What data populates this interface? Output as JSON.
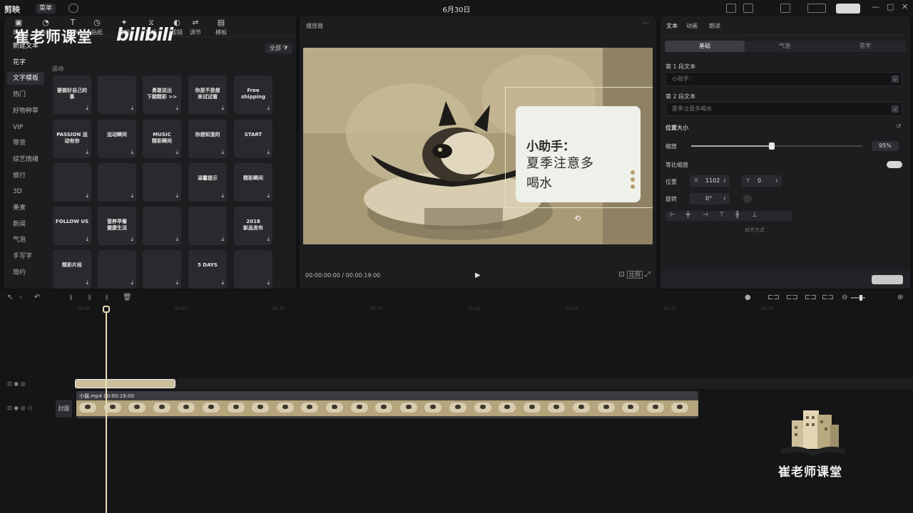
{
  "app": {
    "title": "6月30日",
    "logo": "剪映",
    "menu_label": "菜单"
  },
  "watermark": {
    "title": "崔老师课堂",
    "platform": "bilibili"
  },
  "tool_tabs": [
    {
      "label": "媒体",
      "icon": "media-icon"
    },
    {
      "label": "音频",
      "icon": "audio-icon"
    },
    {
      "label": "文本",
      "icon": "text-icon"
    },
    {
      "label": "贴纸",
      "icon": "sticker-icon"
    },
    {
      "label": "特效",
      "icon": "effect-icon"
    },
    {
      "label": "转场",
      "icon": "transition-icon"
    },
    {
      "label": "滤镜",
      "icon": "filter-icon"
    },
    {
      "label": "调节",
      "icon": "adjust-icon"
    },
    {
      "label": "模板",
      "icon": "template-icon"
    }
  ],
  "sidebar": {
    "items": [
      {
        "label": "新建文本",
        "state": "active"
      },
      {
        "label": "花字",
        "state": "active"
      },
      {
        "label": "文字模板",
        "state": "selected"
      },
      {
        "label": "热门",
        "state": "normal"
      },
      {
        "label": "好物种草",
        "state": "normal"
      },
      {
        "label": "VIP",
        "state": "normal"
      },
      {
        "label": "带货",
        "state": "normal"
      },
      {
        "label": "综艺情绪",
        "state": "normal"
      },
      {
        "label": "旅行",
        "state": "normal"
      },
      {
        "label": "3D",
        "state": "normal"
      },
      {
        "label": "美食",
        "state": "normal"
      },
      {
        "label": "新闻",
        "state": "normal"
      },
      {
        "label": "气泡",
        "state": "normal"
      },
      {
        "label": "手写字",
        "state": "normal"
      },
      {
        "label": "简约",
        "state": "normal"
      }
    ]
  },
  "library": {
    "filter_label": "全部",
    "section_label": "运动",
    "templates": [
      [
        "要做好自己的事",
        "",
        "勇敢说出\n下期精彩 >>",
        "你是不是想\n来试试看",
        "Free shipping"
      ],
      [
        "PASSION 运动有你",
        "运动瞬间",
        "MUSIC\n精彩瞬间",
        "你想知道的",
        "START"
      ],
      [
        "",
        "",
        "",
        "温馨提示",
        "精彩瞬间"
      ],
      [
        "FOLLOW US",
        "营养早餐\n健康生活",
        "",
        "",
        "2018\n新品发布"
      ],
      [
        "精彩片段",
        "",
        "",
        "5 DAYS",
        ""
      ]
    ]
  },
  "player": {
    "title": "播放器",
    "current_time": "00:00:00:00",
    "total_time": "00:00:19:00",
    "ratio_label": "比例",
    "overlay": {
      "title": "小助手：",
      "line1": "夏季注意多",
      "line2": "喝水"
    }
  },
  "properties": {
    "tabs": [
      "文本",
      "动画",
      "朗读"
    ],
    "subtabs": [
      "基础",
      "气泡",
      "花字"
    ],
    "text1_label": "第 1 段文本",
    "text1_value": "小助手：",
    "text2_label": "第 2 段文本",
    "text2_value": "夏季注意多喝水",
    "section_label": "位置大小",
    "scale_label": "缩放",
    "scale_value": "95%",
    "scale_fraction": 0.47,
    "uniform_label": "等比缩放",
    "position_label": "位置",
    "pos_x": "1102",
    "pos_y": "0",
    "rotation_label": "旋转",
    "rotation_value": "0°",
    "align_hint": "对齐方式"
  },
  "timeline": {
    "ruler_ticks": [
      "00:00",
      "00:05",
      "00:10",
      "00:15",
      "00:20",
      "00:25",
      "00:30",
      "00:35"
    ],
    "video_clip_name": "小猫.mp4",
    "video_clip_duration": "00:00:19:00",
    "cover_label": "封面",
    "frame_count": 25
  },
  "brand": {
    "name": "崔老师课堂"
  },
  "colors": {
    "accent": "#cdbf9c",
    "bg": "#121214",
    "panel": "#1d1d20"
  }
}
